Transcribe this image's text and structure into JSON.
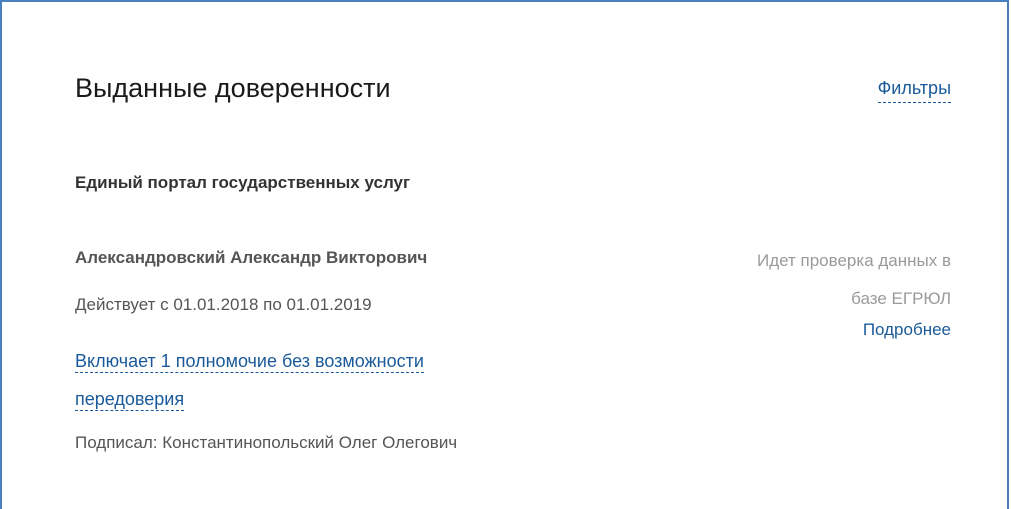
{
  "header": {
    "title": "Выданные доверенности",
    "filters_label": "Фильтры"
  },
  "entry": {
    "organization": "Единый портал государственных услуг",
    "person": "Александровский Александр Викторович",
    "validity": "Действует с 01.01.2018 по 01.01.2019",
    "powers_line1": "Включает 1 полномочие без возможности",
    "powers_line2": "передоверия",
    "signed_by": "Подписал: Константинопольский Олег Олегович",
    "status_line1": "Идет проверка данных в",
    "status_line2": "базе ЕГРЮЛ",
    "details_label": "Подробнее"
  },
  "colors": {
    "border": "#4a7fc1",
    "link": "#1a5a9a",
    "text_primary": "#1a1a1a",
    "text_secondary": "#555555",
    "text_muted": "#9a9a9a"
  }
}
